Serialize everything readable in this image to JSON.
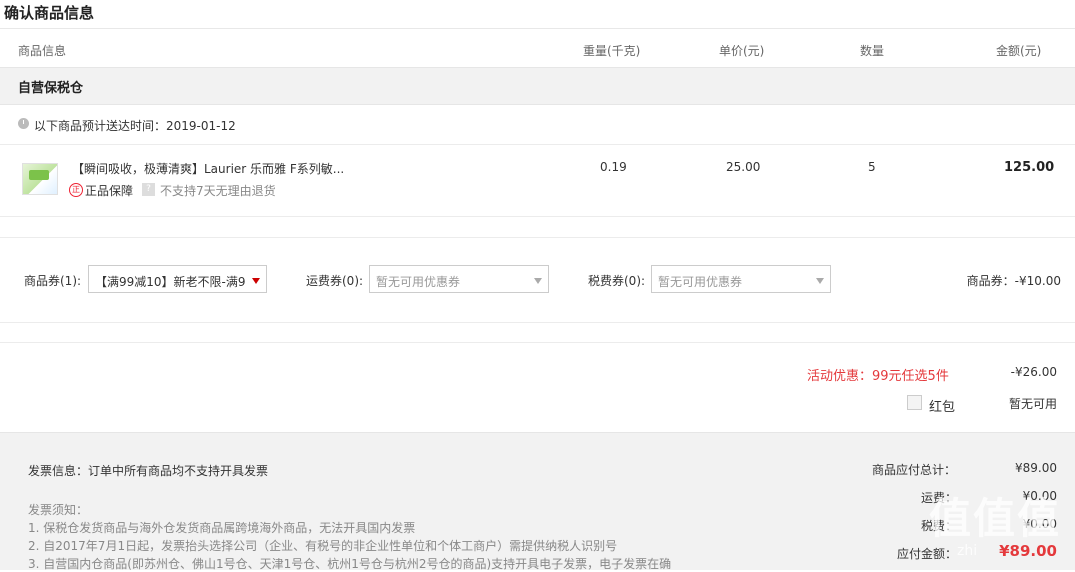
{
  "page_title": "确认商品信息",
  "columns": {
    "info": "商品信息",
    "weight": "重量(千克)",
    "unit_price": "单价(元)",
    "qty": "数量",
    "amount": "金额(元)"
  },
  "warehouse": "自营保税仓",
  "delivery": {
    "icon": "clock-icon",
    "text": "以下商品预计送达时间：2019-01-12"
  },
  "product": {
    "name": "【瞬间吸收，极薄清爽】Laurier 乐而雅 F系列敏...",
    "guarantee_icon": "正",
    "guarantee": "正品保障",
    "no_return_icon": "?",
    "no_return": "不支持7天无理由退货",
    "weight": "0.19",
    "unit_price": "25.00",
    "qty": "5",
    "amount": "125.00"
  },
  "coupons": {
    "goods_label": "商品券(1):",
    "goods_value": "【满99减10】新老不限-满9...",
    "shipping_label": "运费券(0):",
    "shipping_placeholder": "暂无可用优惠券",
    "tax_label": "税费券(0):",
    "tax_placeholder": "暂无可用优惠券",
    "discount": "商品券：-¥10.00",
    "accent": "#e4393c"
  },
  "promotion": {
    "text": "活动优惠：99元任选5件",
    "amount": "-¥26.00"
  },
  "red_packet": {
    "label": "红包",
    "status": "暂无可用"
  },
  "invoice": {
    "info": "发票信息：订单中所有商品均不支持开具发票",
    "notes_title": "发票须知：",
    "notes": [
      "1. 保税仓发货商品与海外仓发货商品属跨境海外商品，无法开具国内发票",
      "2. 自2017年7月1日起，发票抬头选择公司（企业、有税号的非企业性单位和个体工商户）需提供纳税人识别号",
      "3. 自营国内仓商品(即苏州仓、佛山1号仓、天津1号仓、杭州1号仓与杭州2号仓的商品)支持开具电子发票，电子发票在确"
    ]
  },
  "summary": {
    "subtotal_label": "商品应付总计：",
    "subtotal": "¥89.00",
    "shipping_label": "运费：",
    "shipping": "¥0.00",
    "tax_label": "税费：",
    "tax": "¥0.00",
    "total_label": "应付金额：",
    "total": "¥89.00"
  },
  "watermark": {
    "big": "值值值",
    "small": "zhi"
  }
}
